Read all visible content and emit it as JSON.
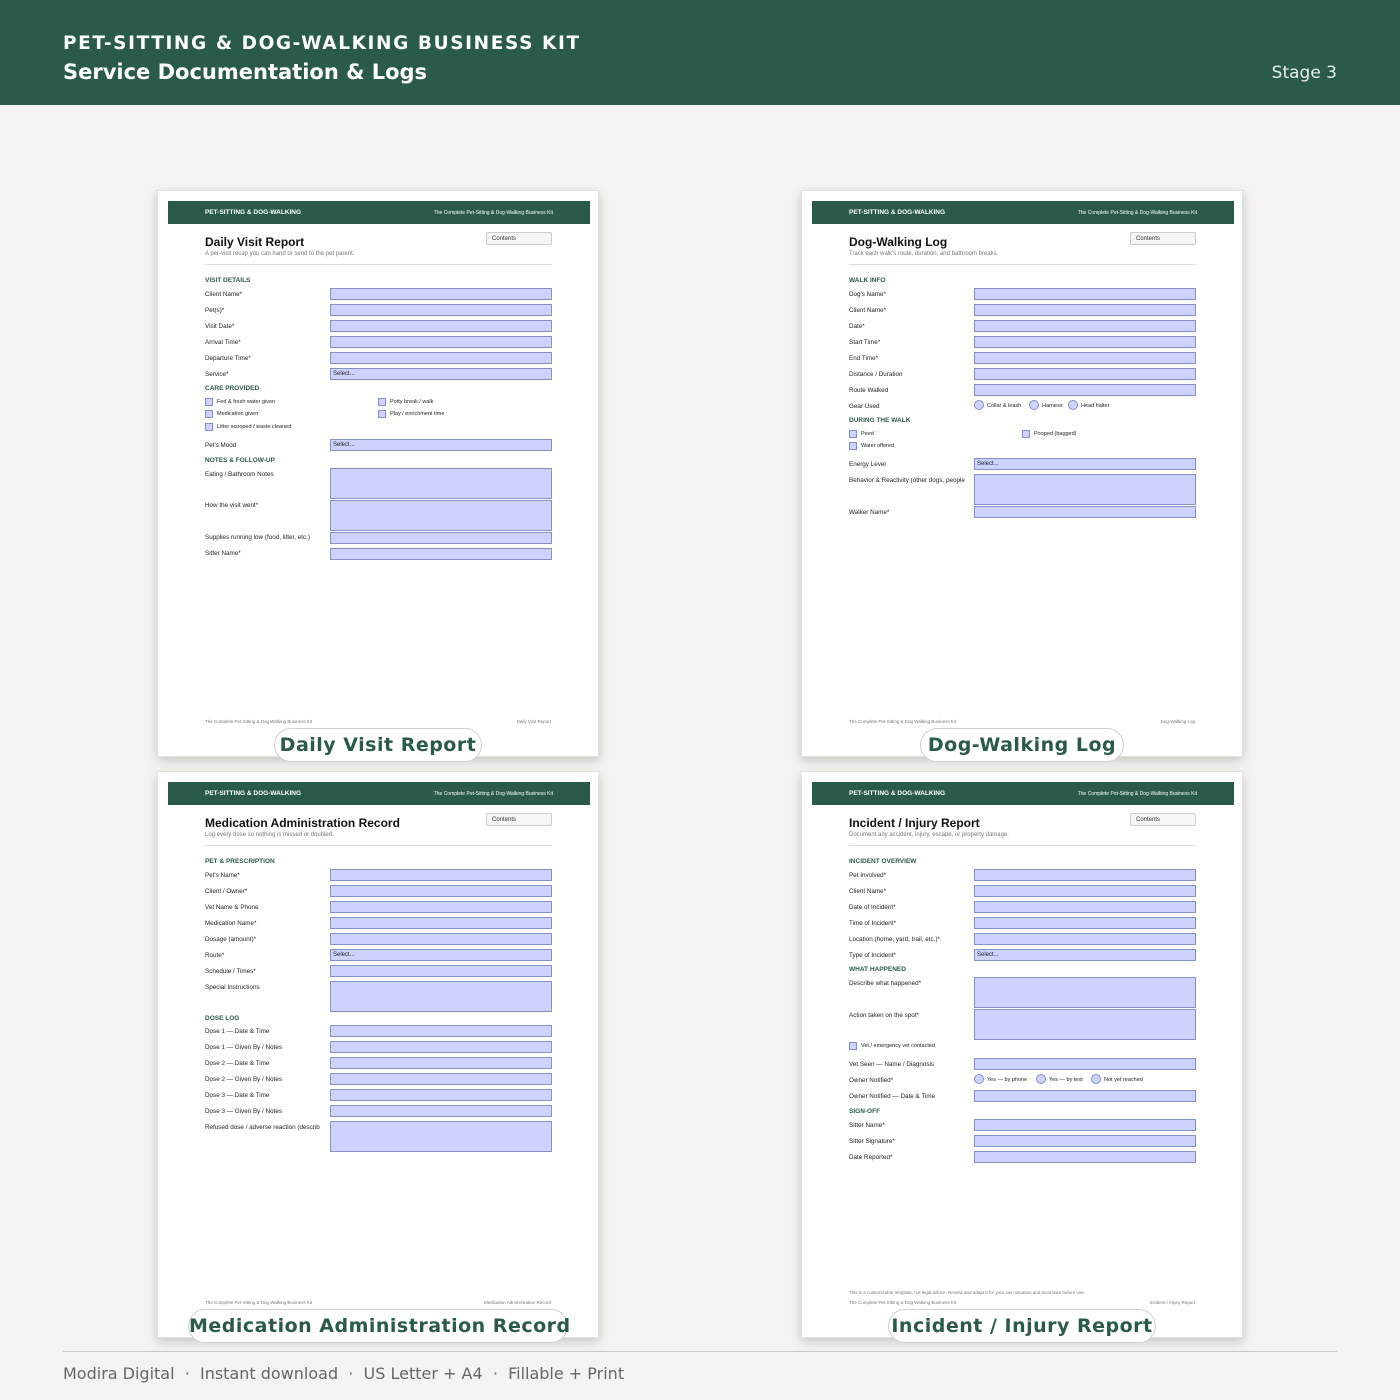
{
  "banner": {
    "kit": "PET-SITTING & DOG-WALKING BUSINESS KIT",
    "subtitle": "Service Documentation & Logs",
    "stage": "Stage 3"
  },
  "page_common": {
    "brand": "PET-SITTING & DOG-WALKING",
    "kit_name": "The Complete Pet-Sitting & Dog-Walking Business Kit",
    "contents": "Contents",
    "select": "Select...",
    "footer_left": "The Complete Pet-Sitting & Dog Walking Business Kit"
  },
  "pages": {
    "daily": {
      "pill": "Daily Visit Report",
      "title": "Daily Visit Report",
      "desc": "A per-visit recap you can hand or send to the pet parent.",
      "footer_right": "Daily Visit Report",
      "sections": [
        "VISIT DETAILS",
        "CARE PROVIDED",
        "NOTES & FOLLOW-UP"
      ],
      "labels": [
        "Client Name*",
        "Pet(s)*",
        "Visit Date*",
        "Arrival Time*",
        "Departure Time*",
        "Service*",
        "Pet's Mood",
        "Eating / Bathroom Notes",
        "How the visit went*",
        "Supplies running low (food, litter, etc.)",
        "Sitter Name*"
      ],
      "checks": [
        "Fed & fresh water given",
        "Medication given",
        "Litter scooped / waste cleaned",
        "Potty break / walk",
        "Play / enrichment time"
      ]
    },
    "walk": {
      "pill": "Dog-Walking Log",
      "title": "Dog-Walking Log",
      "desc": "Track each walk's route, duration, and bathroom breaks.",
      "footer_right": "Dog-Walking Log",
      "sections": [
        "WALK INFO",
        "DURING THE WALK"
      ],
      "labels": [
        "Dog's Name*",
        "Client Name*",
        "Date*",
        "Start Time*",
        "End Time*",
        "Distance / Duration",
        "Route Walked",
        "Gear Used",
        "Energy Level",
        "Behavior & Reactivity (other dogs, people",
        "Walker Name*"
      ],
      "radios": [
        "Collar & leash",
        "Harness",
        "Head halter"
      ],
      "checks": [
        "Peed",
        "Water offered",
        "Pooped (bagged)"
      ]
    },
    "med": {
      "pill": "Medication Administration Record",
      "title": "Medication Administration Record",
      "desc": "Log every dose so nothing is missed or doubled.",
      "footer_right": "Medication Administration Record",
      "sections": [
        "PET & PRESCRIPTION",
        "DOSE LOG"
      ],
      "labels": [
        "Pet's Name*",
        "Client / Owner*",
        "Vet Name & Phone",
        "Medication Name*",
        "Dosage (amount)*",
        "Route*",
        "Schedule / Times*",
        "Special Instructions",
        "Dose 1 — Date & Time",
        "Dose 1 — Given By / Notes",
        "Dose 2 — Date & Time",
        "Dose 2 — Given By / Notes",
        "Dose 3 — Date & Time",
        "Dose 3 — Given By / Notes",
        "Refused dose / adverse reaction (describ"
      ]
    },
    "incident": {
      "pill": "Incident / Injury Report",
      "title": "Incident / Injury Report",
      "desc": "Document any accident, injury, escape, or property damage.",
      "footer_right": "Incident / Injury Report",
      "disclaimer": "This is a customizable template, not legal advice. Review and adapt it for your own situation and local laws before use.",
      "sections": [
        "INCIDENT OVERVIEW",
        "WHAT HAPPENED",
        "SIGN-OFF"
      ],
      "labels": [
        "Pet Involved*",
        "Client Name*",
        "Date of Incident*",
        "Time of Incident*",
        "Location (home, yard, trail, etc.)*",
        "Type of Incident*",
        "Describe what happened*",
        "Action taken on the spot*",
        "Vet Seen — Name / Diagnosis",
        "Owner Notified*",
        "Owner Notified — Date & Time",
        "Sitter Name*",
        "Sitter Signature*",
        "Date Reported*"
      ],
      "checks": [
        "Vet / emergency vet contacted"
      ],
      "radios": [
        "Yes — by phone",
        "Yes — by text",
        "Not yet reached"
      ]
    }
  },
  "footer": {
    "text": "Modira Digital  ·  Instant download  ·  US Letter + A4  ·  Fillable + Print"
  }
}
